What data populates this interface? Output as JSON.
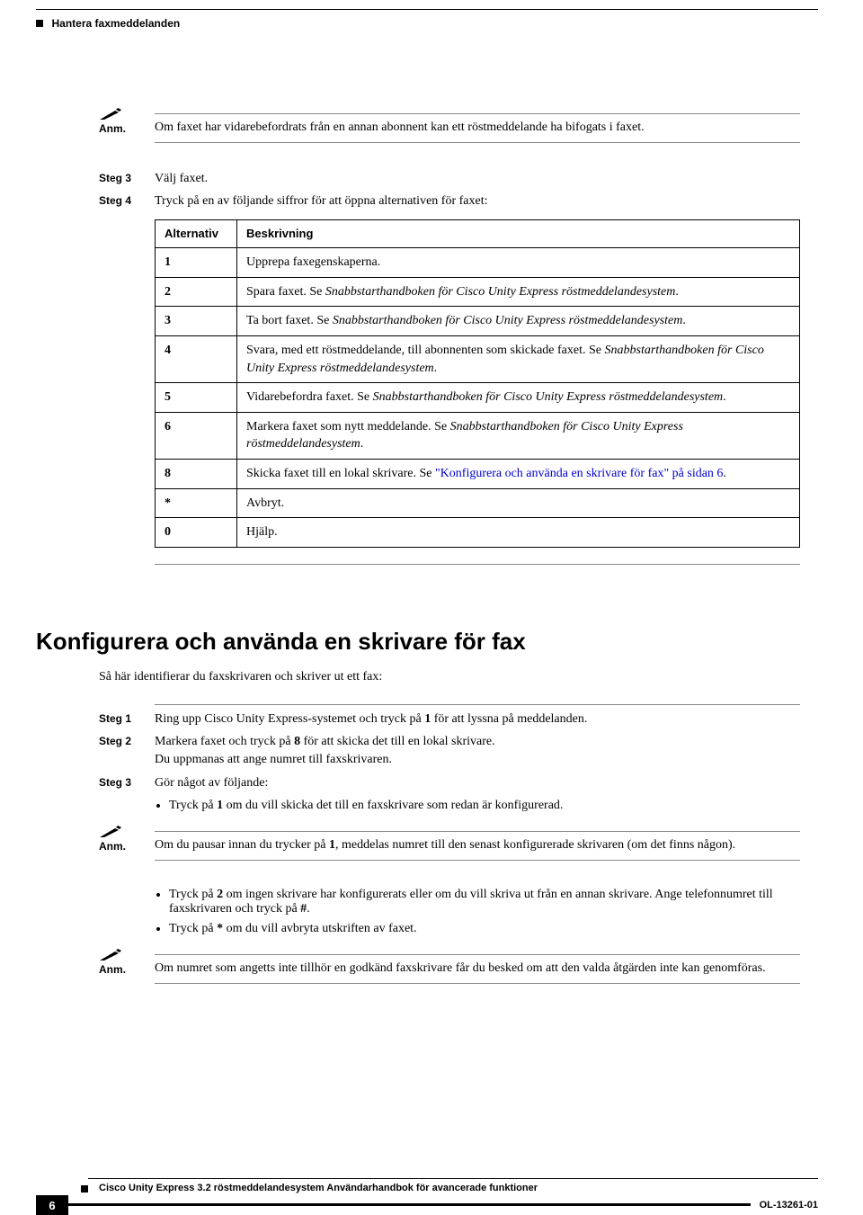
{
  "header": {
    "title": "Hantera faxmeddelanden"
  },
  "note1": {
    "label": "Anm.",
    "text": "Om faxet har vidarebefordrats från en annan abonnent kan ett röstmeddelande ha bifogats i faxet."
  },
  "steps_a": {
    "s3": {
      "label": "Steg 3",
      "text": "Välj faxet."
    },
    "s4": {
      "label": "Steg 4",
      "text": "Tryck på en av följande siffror för att öppna alternativen för faxet:"
    }
  },
  "table": {
    "h1": "Alternativ",
    "h2": "Beskrivning",
    "rows": [
      {
        "k": "1",
        "v_plain": "Upprepa faxegenskaperna."
      },
      {
        "k": "2",
        "v_pre": "Spara faxet. Se ",
        "v_it": "Snabbstarthandboken för Cisco Unity Express röstmeddelandesystem",
        "v_post": "."
      },
      {
        "k": "3",
        "v_pre": "Ta bort faxet. Se ",
        "v_it": "Snabbstarthandboken för Cisco Unity Express röstmeddelandesystem",
        "v_post": "."
      },
      {
        "k": "4",
        "v_pre": "Svara, med ett röstmeddelande, till abonnenten som skickade faxet. Se ",
        "v_it": "Snabbstarthandboken för Cisco Unity Express röstmeddelandesystem",
        "v_post": "."
      },
      {
        "k": "5",
        "v_pre": "Vidarebefordra faxet. Se ",
        "v_it": "Snabbstarthandboken för Cisco Unity Express röstmeddelandesystem",
        "v_post": "."
      },
      {
        "k": "6",
        "v_pre": "Markera faxet som nytt meddelande. Se ",
        "v_it": "Snabbstarthandboken för Cisco Unity Express röstmeddelandesystem",
        "v_post": "."
      },
      {
        "k": "8",
        "v_pre": "Skicka faxet till en lokal skrivare. Se ",
        "v_link": "\"Konfigurera och använda en skrivare för fax\" på sidan 6",
        "v_post2": "."
      },
      {
        "k": "*",
        "v_plain": "Avbryt."
      },
      {
        "k": "0",
        "v_plain": "Hjälp."
      }
    ]
  },
  "section": {
    "title": "Konfigurera och använda en skrivare för fax",
    "intro": "Så här identifierar du faxskrivaren och skriver ut ett fax:"
  },
  "steps_b": {
    "s1": {
      "label": "Steg 1",
      "pre": "Ring upp Cisco Unity Express-systemet och tryck på ",
      "bold": "1",
      "post": " för att lyssna på meddelanden."
    },
    "s2": {
      "label": "Steg 2",
      "pre": "Markera faxet och tryck på ",
      "bold": "8",
      "post": " för att skicka det till en lokal skrivare.",
      "line2": "Du uppmanas att ange numret till faxskrivaren."
    },
    "s3": {
      "label": "Steg 3",
      "text": "Gör något av följande:",
      "bullet_pre": "Tryck på ",
      "bullet_bold": "1",
      "bullet_post": " om du vill skicka det till en faxskrivare som redan är konfigurerad."
    }
  },
  "note2": {
    "label": "Anm.",
    "pre": "Om du pausar innan du trycker på ",
    "bold": "1",
    "post": ", meddelas numret till den senast konfigurerade skrivaren (om det finns någon)."
  },
  "bullets2": {
    "a_pre": "Tryck på ",
    "a_b1": "2",
    "a_mid": " om ingen skrivare har konfigurerats eller om du vill skriva ut från en annan skrivare. Ange telefonnumret till faxskrivaren och tryck på ",
    "a_b2": "#",
    "a_post": ".",
    "b_pre": "Tryck på ",
    "b_b1": "*",
    "b_post": " om du vill avbryta utskriften av faxet."
  },
  "note3": {
    "label": "Anm.",
    "text": "Om numret som angetts inte tillhör en godkänd faxskrivare får du besked om att den valda åtgärden inte kan genomföras."
  },
  "footer": {
    "doc_title": "Cisco Unity Express 3.2 röstmeddelandesystem Användarhandbok för avancerade funktioner",
    "page_number": "6",
    "doc_id": "OL-13261-01"
  }
}
